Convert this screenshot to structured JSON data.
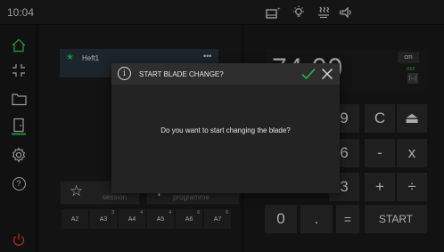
{
  "status_bar": {
    "time": "10:04",
    "icons": [
      "book-rotate-icon",
      "light-bulb-icon",
      "air-blow-icon",
      "speaker-icon"
    ]
  },
  "sidebar": {
    "items": [
      {
        "icon": "home-icon"
      },
      {
        "icon": "fullscreen-icon"
      },
      {
        "icon": "folder-icon"
      },
      {
        "icon": "door-icon"
      },
      {
        "icon": "settings-icon"
      },
      {
        "icon": "help-icon",
        "glyph": "?"
      },
      {
        "icon": "power-icon"
      }
    ]
  },
  "session": {
    "heft_name": "Heft1",
    "menu_glyph": "•••",
    "favourite_icon": "☆",
    "session_label": "session",
    "program_icon": "+",
    "program_label": "programme",
    "formats": [
      {
        "label": "A2",
        "badge": ""
      },
      {
        "label": "A3",
        "badge": "3"
      },
      {
        "label": "A4",
        "badge": "4"
      },
      {
        "label": "A5",
        "badge": "4"
      },
      {
        "label": "A6",
        "badge": "6"
      },
      {
        "label": "A7",
        "badge": "6"
      }
    ]
  },
  "keypad": {
    "display_value": "74.00",
    "unit": "cm",
    "ref_label": "REF",
    "ref_button": "|↔|",
    "keys": {
      "nine": "9",
      "clear": "C",
      "eject": "⏏",
      "six": "6",
      "minus": "-",
      "multiply": "x",
      "three": "3",
      "plus": "+",
      "divide": "÷",
      "zero": "0",
      "decimal": ".",
      "equals": "=",
      "start": "START"
    }
  },
  "dialog": {
    "info_glyph": "i",
    "title": "START BLADE CHANGE?",
    "message": "Do you want to start changing the blade?",
    "confirm_icon": "checkmark-icon",
    "cancel_icon": "close-icon"
  },
  "colors": {
    "accent_green": "#27c04a",
    "power_red": "#d9372b",
    "background": "#151515"
  }
}
